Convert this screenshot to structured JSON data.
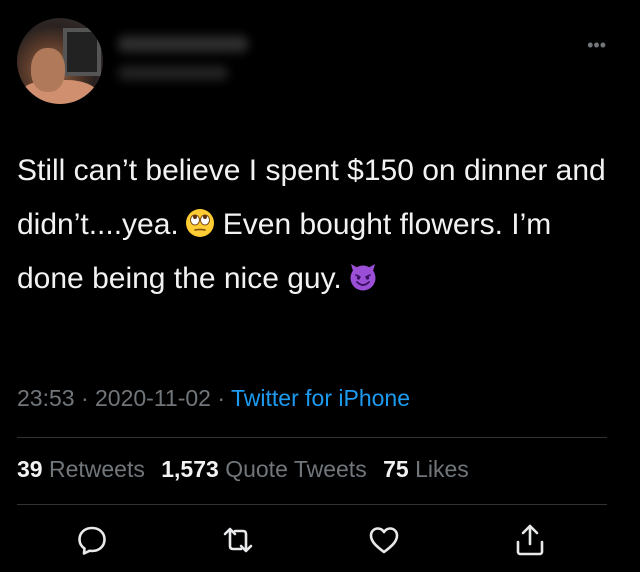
{
  "tweet": {
    "more_label": "•••",
    "text_part1": "Still can’t believe I spent $150 on dinner and didn’t....yea.",
    "text_part2": "Even bought flowers. I’m done being the nice guy.",
    "emoji_1": "face-with-rolling-eyes-emoji",
    "emoji_2": "smiling-face-with-horns-emoji",
    "time": "23:53",
    "separator": "·",
    "date": "2020-11-02",
    "source": "Twitter for iPhone"
  },
  "stats": {
    "retweets_count": "39",
    "retweets_label": "Retweets",
    "quotes_count": "1,573",
    "quotes_label": "Quote Tweets",
    "likes_count": "75",
    "likes_label": "Likes"
  },
  "actions": [
    "reply-icon",
    "retweet-icon",
    "like-icon",
    "share-icon"
  ],
  "colors": {
    "background": "#000000",
    "text": "#f2f2f2",
    "muted": "#71767b",
    "link": "#1d9bf0",
    "divider": "#2f3336"
  }
}
